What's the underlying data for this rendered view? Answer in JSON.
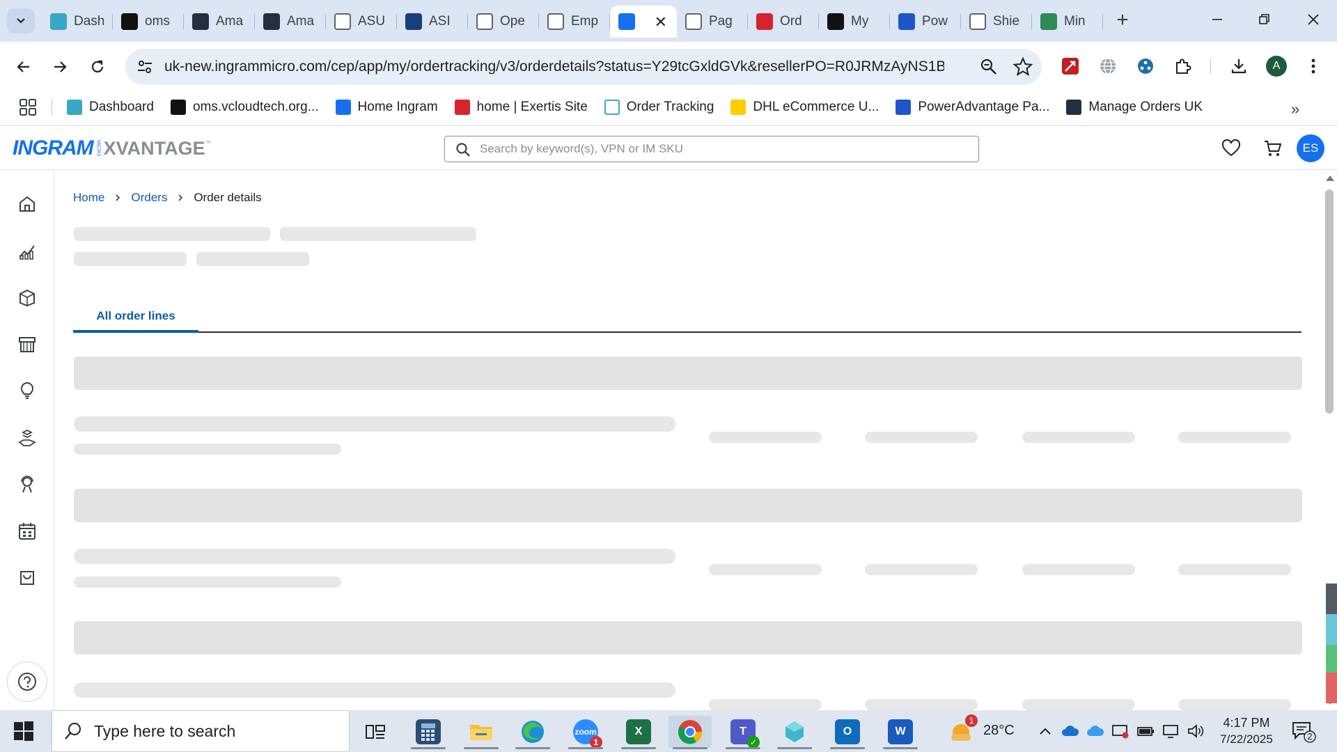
{
  "browser": {
    "tabs": [
      {
        "title": "Dash",
        "icon": "ingram-dashboard-icon",
        "color": "#3aa6c8"
      },
      {
        "title": "oms",
        "icon": "oms-icon",
        "color": "#111111"
      },
      {
        "title": "Ama",
        "icon": "amazon-icon",
        "color": "#232f3e"
      },
      {
        "title": "Ama",
        "icon": "amazon-icon",
        "color": "#232f3e"
      },
      {
        "title": "ASU",
        "icon": "amazon-icon",
        "color": "#ffffff"
      },
      {
        "title": "ASI",
        "icon": "arrow-icon",
        "color": "#1a3d7c"
      },
      {
        "title": "Ope",
        "icon": "openai-icon",
        "color": "#ffffff"
      },
      {
        "title": "Emp",
        "icon": "openai-icon",
        "color": "#ffffff"
      },
      {
        "title": "",
        "icon": "ingram-icon",
        "color": "#1570ef",
        "active": true
      },
      {
        "title": "Pag",
        "icon": "curve-icon",
        "color": "#ffffff"
      },
      {
        "title": "Ord",
        "icon": "exertis-icon",
        "color": "#d6242f"
      },
      {
        "title": "My",
        "icon": "tag-icon",
        "color": "#111111"
      },
      {
        "title": "Pow",
        "icon": "powerad-icon",
        "color": "#1f55c8"
      },
      {
        "title": "Shie",
        "icon": "google-icon",
        "color": "#ffffff"
      },
      {
        "title": "Min",
        "icon": "leaf-icon",
        "color": "#2e8b57"
      }
    ],
    "active_tab_close": "✕",
    "new_tab": "+",
    "url": "uk-new.ingrammicro.com/cep/app/my/ordertracking/v3/orderdetails?status=Y29tcGxldGVk&resellerPO=R0JRMzAyNS1B...",
    "profile_initial": "A",
    "bookmarks": [
      {
        "label": "Dashboard",
        "color": "#3aa6c8"
      },
      {
        "label": "oms.vcloudtech.org...",
        "color": "#111111"
      },
      {
        "label": "Home Ingram",
        "color": "#1570ef"
      },
      {
        "label": "home | Exertis Site",
        "color": "#d6242f"
      },
      {
        "label": "Order Tracking",
        "color": "#ffffff"
      },
      {
        "label": "DHL eCommerce U...",
        "color": "#ffcc00"
      },
      {
        "label": "PowerAdvantage Pa...",
        "color": "#1f55c8"
      },
      {
        "label": "Manage Orders UK",
        "color": "#232f3e"
      }
    ],
    "bookmarks_more": "»"
  },
  "app": {
    "logo_ingram": "INGRAM",
    "logo_micro": "MICRO",
    "logo_xvantage": "XVANTAGE",
    "logo_tm": "™",
    "search_placeholder": "Search by keyword(s), VPN or IM SKU",
    "user_initials": "ES",
    "breadcrumb": {
      "home": "Home",
      "orders": "Orders",
      "current": "Order details"
    },
    "tabs": [
      {
        "label": "All order lines",
        "active": true
      }
    ],
    "accent_color": "#0b5cab"
  },
  "taskbar": {
    "search_text": "Type here to search",
    "zoom_badge": "1",
    "weather_badge": "1",
    "temperature": "28°C",
    "time": "4:17 PM",
    "date": "7/22/2025",
    "notification_count": "2"
  }
}
